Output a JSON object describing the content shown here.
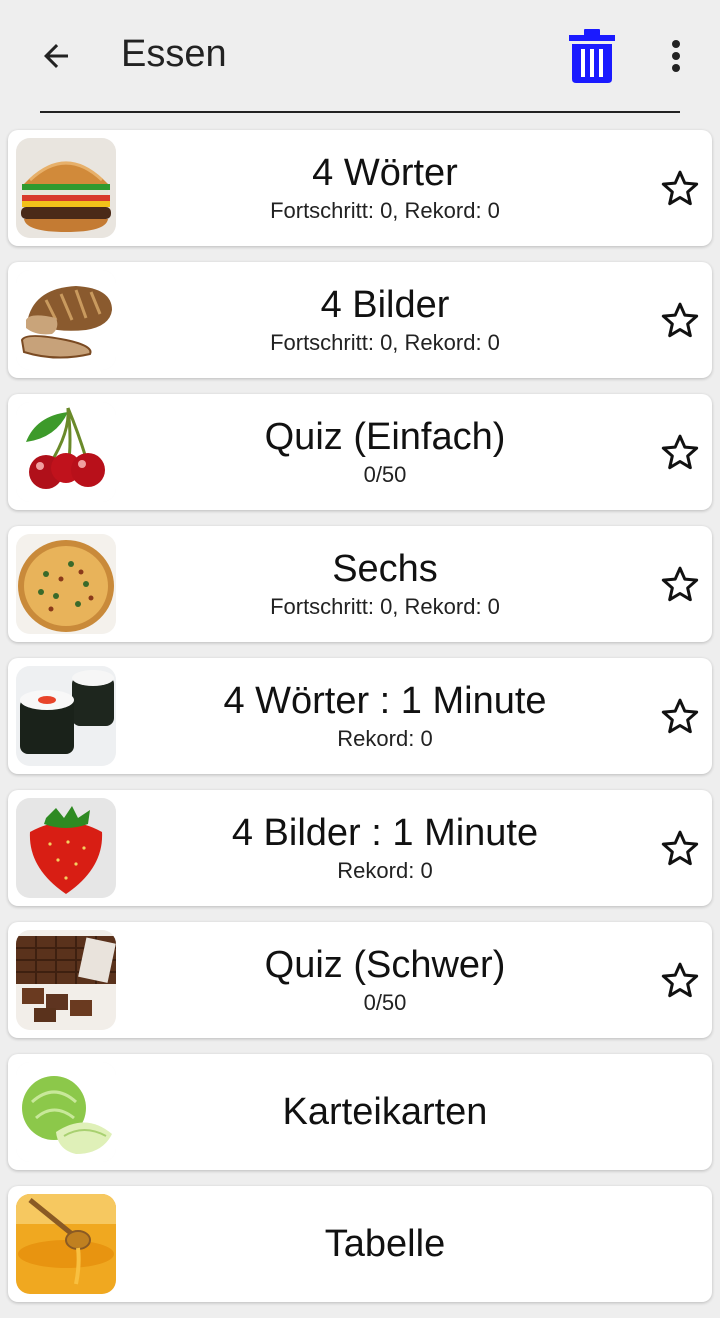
{
  "header": {
    "title": "Essen",
    "back_icon": "arrow-left-icon",
    "delete_icon": "trash-icon",
    "menu_icon": "more-vert-icon",
    "accent_color": "#1a1aff"
  },
  "items": [
    {
      "title": "4 Wörter",
      "subtitle": "Fortschritt: 0, Rekord: 0",
      "image": "burger",
      "starred": false
    },
    {
      "title": "4 Bilder",
      "subtitle": "Fortschritt: 0, Rekord: 0",
      "image": "bread",
      "starred": false
    },
    {
      "title": "Quiz (Einfach)",
      "subtitle": "0/50",
      "image": "cherries",
      "starred": false
    },
    {
      "title": "Sechs",
      "subtitle": "Fortschritt: 0, Rekord: 0",
      "image": "pizza",
      "starred": false
    },
    {
      "title": "4 Wörter : 1 Minute",
      "subtitle": "Rekord: 0",
      "image": "sushi",
      "starred": false
    },
    {
      "title": "4 Bilder : 1 Minute",
      "subtitle": "Rekord: 0",
      "image": "strawberry",
      "starred": false
    },
    {
      "title": "Quiz (Schwer)",
      "subtitle": "0/50",
      "image": "chocolate",
      "starred": false
    },
    {
      "title": "Karteikarten",
      "image": "cabbage"
    },
    {
      "title": "Tabelle",
      "image": "honey"
    }
  ]
}
